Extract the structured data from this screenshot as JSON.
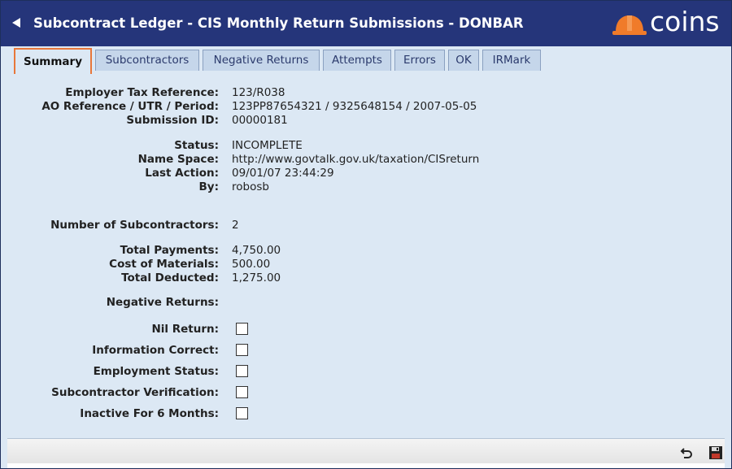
{
  "window": {
    "title": "Subcontract Ledger - CIS Monthly Return Submissions - DONBAR",
    "logo_text": "coins"
  },
  "tabs": [
    {
      "label": "Summary",
      "active": true
    },
    {
      "label": "Subcontractors"
    },
    {
      "label": "Negative Returns"
    },
    {
      "label": "Attempts"
    },
    {
      "label": "Errors"
    },
    {
      "label": "OK"
    },
    {
      "label": "IRMark"
    }
  ],
  "summary": {
    "employer_tax_reference": {
      "label": "Employer Tax Reference:",
      "value": "123/R038"
    },
    "ao_reference": {
      "label": "AO Reference / UTR / Period:",
      "value": "123PP87654321 / 9325648154 / 2007-05-05"
    },
    "submission_id": {
      "label": "Submission ID:",
      "value": "00000181"
    },
    "status": {
      "label": "Status:",
      "value": "INCOMPLETE"
    },
    "name_space": {
      "label": "Name Space:",
      "value": "http://www.govtalk.gov.uk/taxation/CISreturn"
    },
    "last_action": {
      "label": "Last Action:",
      "value": "09/01/07 23:44:29"
    },
    "by": {
      "label": "By:",
      "value": "robosb"
    },
    "num_subcontractors": {
      "label": "Number of Subcontractors:",
      "value": "2"
    },
    "total_payments": {
      "label": "Total Payments:",
      "value": "4,750.00"
    },
    "cost_of_materials": {
      "label": "Cost of Materials:",
      "value": "500.00"
    },
    "total_deducted": {
      "label": "Total Deducted:",
      "value": "1,275.00"
    },
    "negative_returns": {
      "label": "Negative Returns:"
    }
  },
  "declarations": [
    {
      "label": "Nil Return:",
      "checked": false
    },
    {
      "label": "Information Correct:",
      "checked": false
    },
    {
      "label": "Employment Status:",
      "checked": false
    },
    {
      "label": "Subcontractor Verification:",
      "checked": false
    },
    {
      "label": "Inactive For 6 Months:",
      "checked": false
    }
  ],
  "colors": {
    "title_bar": "#25357a",
    "panel_background": "#dce8f4",
    "active_tab_border": "#e8773a",
    "logo_hardhat": "#f07b2a"
  },
  "icons": {
    "back": "back-arrow-icon",
    "logo": "hardhat-icon",
    "undo": "undo-icon",
    "save": "save-icon"
  }
}
